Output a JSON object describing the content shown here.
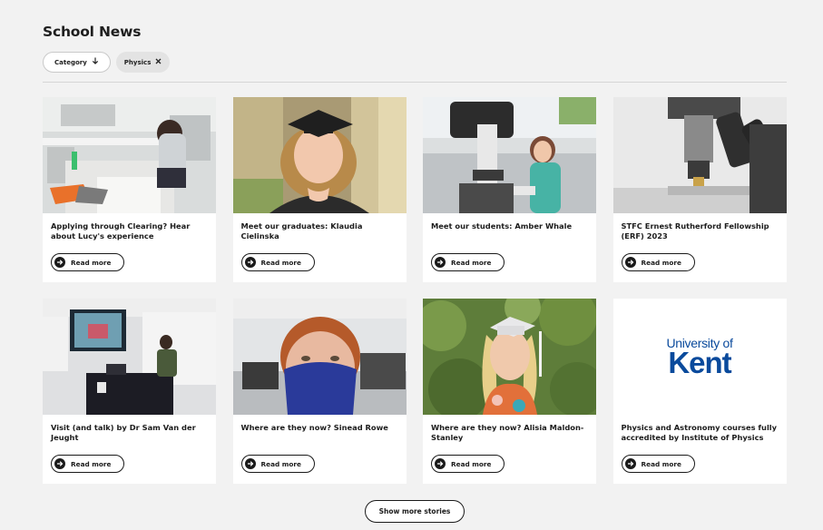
{
  "page": {
    "title": "School News"
  },
  "filters": {
    "category_label": "Category",
    "active_tag": "Physics"
  },
  "cards": [
    {
      "title": "Applying through Clearing? Hear about Lucy's experience",
      "cta": "Read more"
    },
    {
      "title": "Meet our graduates: Klaudia Cielinska",
      "cta": "Read more"
    },
    {
      "title": "Meet our students: Amber Whale",
      "cta": "Read more"
    },
    {
      "title": "STFC Ernest Rutherford Fellowship (ERF) 2023",
      "cta": "Read more"
    },
    {
      "title": "Visit (and talk) by Dr Sam Van der Jeught",
      "cta": "Read more"
    },
    {
      "title": "Where are they now? Sinead Rowe",
      "cta": "Read more"
    },
    {
      "title": "Where are they now? Alisia Maldon-Stanley",
      "cta": "Read more"
    },
    {
      "title": "Physics and Astronomy courses fully accredited by Institute of Physics",
      "cta": "Read more",
      "logo_small": "University of",
      "logo_big": "Kent"
    }
  ],
  "show_more_label": "Show more stories",
  "icons": {
    "category_dropdown": "arrow-down-icon",
    "remove_tag": "close-icon",
    "read_more": "arrow-right-circle-icon"
  },
  "colors": {
    "brand_blue": "#0a4a9c",
    "background": "#f2f2f2"
  }
}
